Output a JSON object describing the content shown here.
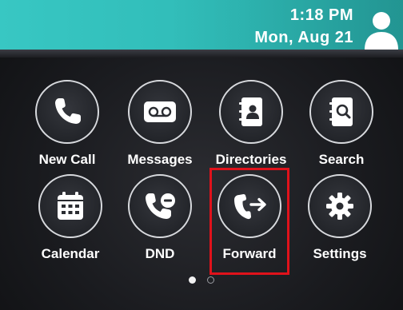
{
  "status": {
    "time": "1:18 PM",
    "date": "Mon, Aug 21",
    "avatar_icon": "user-avatar-icon",
    "bar_color": "#35c2be"
  },
  "apps": [
    {
      "label": "New Call",
      "icon": "phone-icon"
    },
    {
      "label": "Messages",
      "icon": "voicemail-icon"
    },
    {
      "label": "Directories",
      "icon": "contacts-book-icon"
    },
    {
      "label": "Search",
      "icon": "search-book-icon"
    },
    {
      "label": "Calendar",
      "icon": "calendar-icon"
    },
    {
      "label": "DND",
      "icon": "phone-dnd-icon"
    },
    {
      "label": "Forward",
      "icon": "phone-forward-icon"
    },
    {
      "label": "Settings",
      "icon": "gear-icon"
    }
  ],
  "highlight": {
    "target": "Forward",
    "color": "#e0121b"
  },
  "pagination": {
    "pages": 2,
    "current": 1
  }
}
